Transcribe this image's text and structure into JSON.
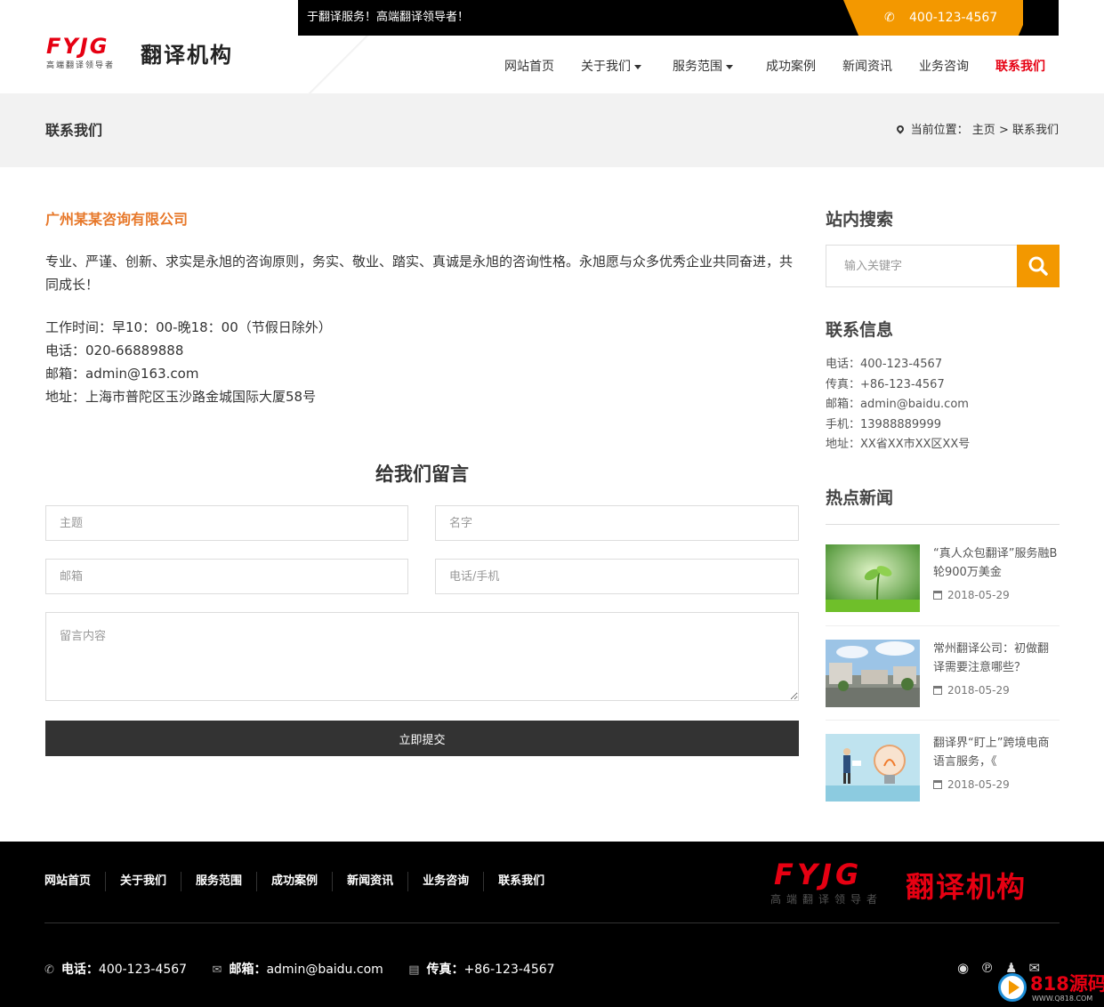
{
  "header": {
    "slogan": "于翻译服务！高端翻译领导者！",
    "phone": "400-123-4567",
    "logo_en": "FYJG",
    "logo_sub": "高端翻译领导者",
    "logo_cn": "翻译机构"
  },
  "nav": {
    "items": [
      {
        "label": "网站首页"
      },
      {
        "label": "关于我们"
      },
      {
        "label": "服务范围"
      },
      {
        "label": "成功案例"
      },
      {
        "label": "新闻资讯"
      },
      {
        "label": "业务咨询"
      },
      {
        "label": "联系我们"
      }
    ]
  },
  "titlebar": {
    "title": "联系我们",
    "breadcrumb_prefix": "当前位置：",
    "crumb_home": "主页",
    "crumb_sep": ">",
    "crumb_current": "联系我们"
  },
  "main": {
    "company": "广州某某咨询有限公司",
    "intro": "专业、严谨、创新、求实是永旭的咨询原则，务实、敬业、踏实、真诚是永旭的咨询性格。永旭愿与众多优秀企业共同奋进，共同成长！",
    "hours": "工作时间：早10：00-晚18：00（节假日除外）",
    "tel": "电话：020-66889888",
    "email": "邮箱：admin@163.com",
    "address": "地址：上海市普陀区玉沙路金城国际大厦58号"
  },
  "form": {
    "title": "给我们留言",
    "subject_placeholder": "主题",
    "name_placeholder": "名字",
    "email_placeholder": "邮箱",
    "phone_placeholder": "电话/手机",
    "message_placeholder": "留言内容",
    "submit_label": "立即提交"
  },
  "sidebar": {
    "search_heading": "站内搜索",
    "search_placeholder": "输入关键字",
    "contact_heading": "联系信息",
    "contact": {
      "tel": "电话：400-123-4567",
      "fax": "传真：+86-123-4567",
      "email": "邮箱：admin@baidu.com",
      "mobile": "手机：13988889999",
      "address": "地址：XX省XX市XX区XX号"
    },
    "news_heading": "热点新闻",
    "news": [
      {
        "title": "“真人众包翻译”服务融B轮900万美金",
        "date": "2018-05-29"
      },
      {
        "title": "常州翻译公司：初做翻译需要注意哪些？",
        "date": "2018-05-29"
      },
      {
        "title": "翻译界“盯上”跨境电商语言服务，《",
        "date": "2018-05-29"
      }
    ]
  },
  "footer": {
    "nav": [
      "网站首页",
      "关于我们",
      "服务范围",
      "成功案例",
      "新闻资讯",
      "业务咨询",
      "联系我们"
    ],
    "logo_en": "FYJG",
    "logo_sub": "高端翻译领导者",
    "logo_cn": "翻译机构",
    "tel_label": "电话：",
    "tel": "400-123-4567",
    "email_label": "邮箱：",
    "email": "admin@baidu.com",
    "fax_label": "传真：",
    "fax": "+86-123-4567",
    "social_icons": [
      "weibo-icon",
      "pinterest-icon",
      "qq-icon",
      "mail-icon"
    ]
  },
  "watermark": {
    "text": "818源码",
    "sub": "WWW.Q818.COM"
  },
  "colors": {
    "accent": "#f39800",
    "brand_red": "#e60012",
    "company_orange": "#e7782a",
    "footer_bg": "#000000",
    "submit_bg": "#333333"
  }
}
